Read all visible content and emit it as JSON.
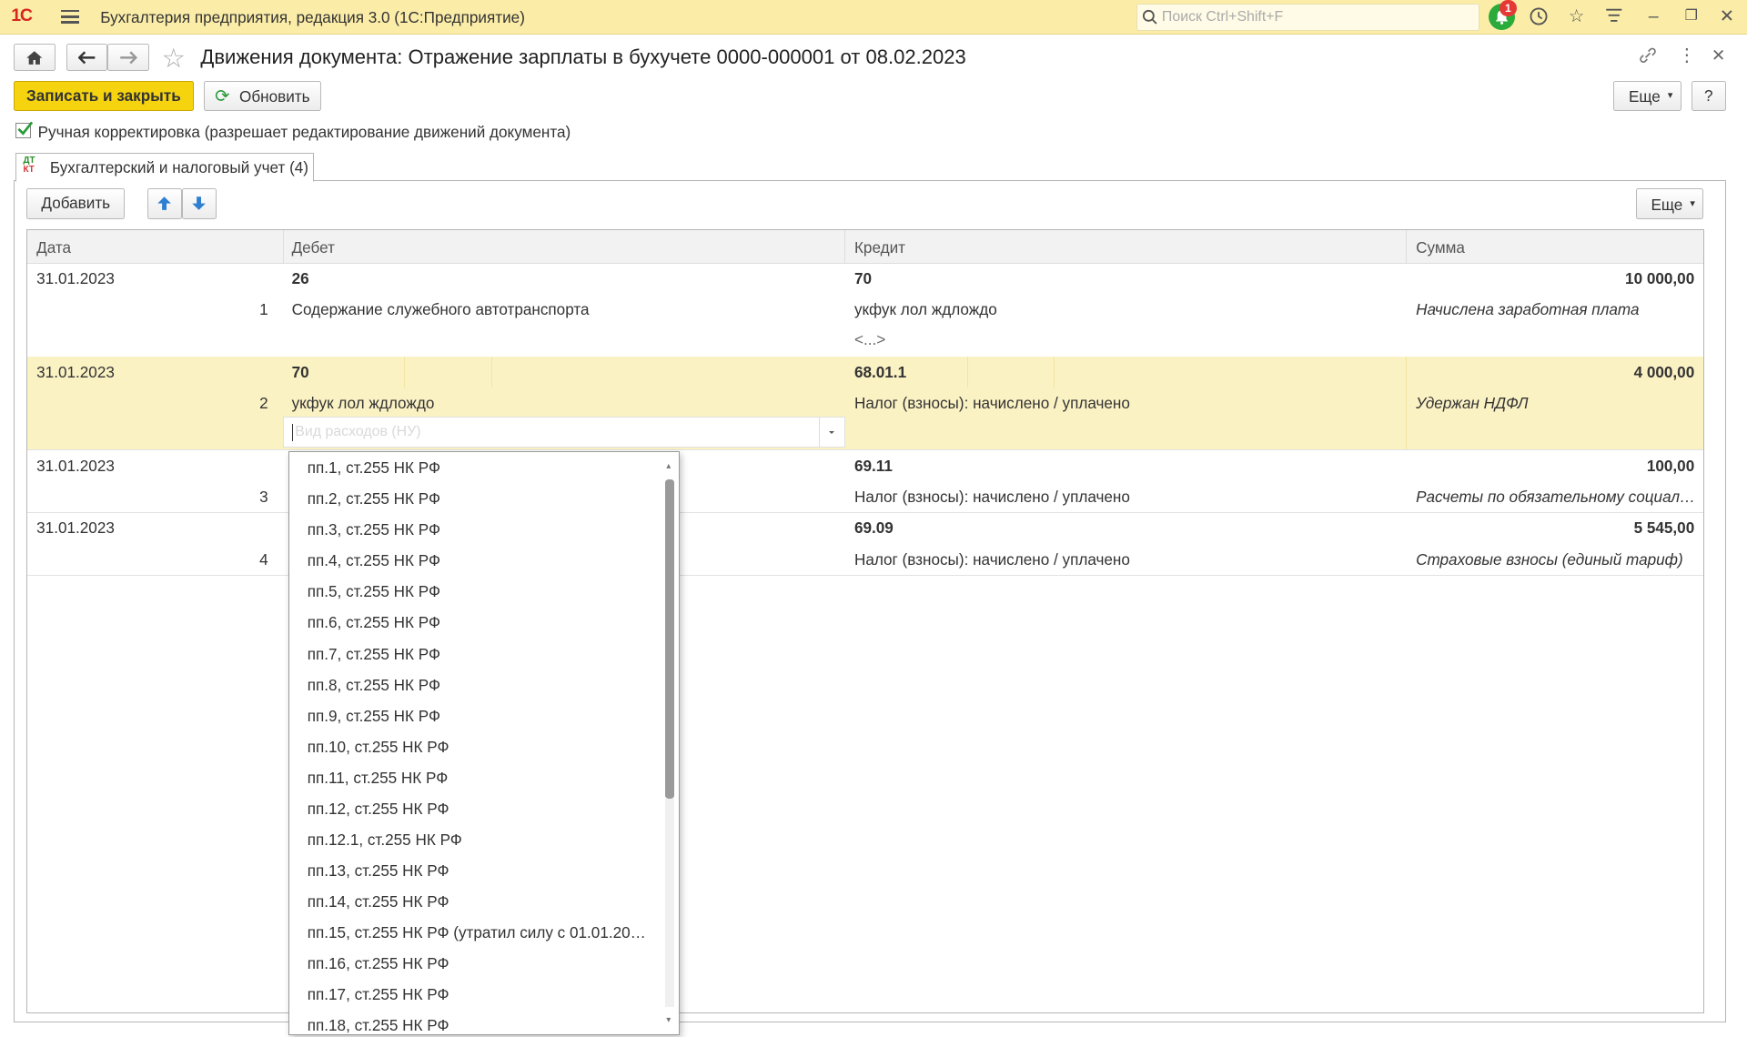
{
  "window": {
    "logo": "1С",
    "app_title": "Бухгалтерия предприятия, редакция 3.0  (1С:Предприятие)",
    "search_placeholder": "Поиск Ctrl+Shift+F",
    "notification_count": "1"
  },
  "document": {
    "title": "Движения документа: Отражение зарплаты в бухучете 0000-000001 от 08.02.2023"
  },
  "toolbar": {
    "save_close": "Записать и закрыть",
    "refresh": "Обновить",
    "more": "Еще",
    "help": "?"
  },
  "manual_edit": {
    "checked": true,
    "label": "Ручная корректировка (разрешает редактирование движений документа)"
  },
  "tab": {
    "icon_top": "ДТ",
    "icon_bottom": "КТ",
    "label": "Бухгалтерский и налоговый учет (4)"
  },
  "grid_toolbar": {
    "add": "Добавить",
    "more": "Еще"
  },
  "table": {
    "headers": [
      "Дата",
      "Дебет",
      "Кредит",
      "Сумма"
    ],
    "rows": [
      {
        "date": "31.01.2023",
        "num": "1",
        "debit_account": "26",
        "debit_sub": "Содержание служебного автотранспорта",
        "credit_account": "70",
        "credit_sub": "укфук лол ждлождо",
        "credit_extra": "<...>",
        "amount": "10 000,00",
        "content": "Начислена заработная плата"
      },
      {
        "date": "31.01.2023",
        "num": "2",
        "debit_account": "70",
        "debit_sub": "укфук лол ждлождо",
        "credit_account": "68.01.1",
        "credit_sub": "Налог (взносы): начислено / уплачено",
        "amount": "4 000,00",
        "content": "Удержан НДФЛ"
      },
      {
        "date": "31.01.2023",
        "num": "3",
        "debit_account": "",
        "debit_sub": "",
        "credit_account": "69.11",
        "credit_sub": "Налог (взносы): начислено / уплачено",
        "amount": "100,00",
        "content": "Расчеты по обязательному социал…"
      },
      {
        "date": "31.01.2023",
        "num": "4",
        "debit_account": "",
        "debit_sub": "",
        "credit_account": "69.09",
        "credit_sub": "Налог (взносы): начислено / уплачено",
        "amount": "5 545,00",
        "content": "Страховые взносы (единый тариф)"
      }
    ]
  },
  "dropdown": {
    "field_placeholder": "Вид расходов (НУ)",
    "items": [
      "пп.1, ст.255 НК РФ",
      "пп.2, ст.255 НК РФ",
      "пп.3, ст.255 НК РФ",
      "пп.4, ст.255 НК РФ",
      "пп.5, ст.255 НК РФ",
      "пп.6, ст.255 НК РФ",
      "пп.7, ст.255 НК РФ",
      "пп.8, ст.255 НК РФ",
      "пп.9, ст.255 НК РФ",
      "пп.10, ст.255 НК РФ",
      "пп.11, ст.255 НК РФ",
      "пп.12, ст.255 НК РФ",
      "пп.12.1, ст.255 НК РФ",
      "пп.13, ст.255 НК РФ",
      "пп.14, ст.255 НК РФ",
      "пп.15, ст.255 НК РФ (утратил силу с 01.01.20…",
      "пп.16, ст.255 НК РФ",
      "пп.17, ст.255 НК РФ",
      "пп.18, ст.255 НК РФ"
    ]
  },
  "colors": {
    "topbar": "#fbeda8",
    "accent_button": "#f5d30f",
    "selected_row": "#fbf2c4",
    "notification": "#2bab3a"
  }
}
